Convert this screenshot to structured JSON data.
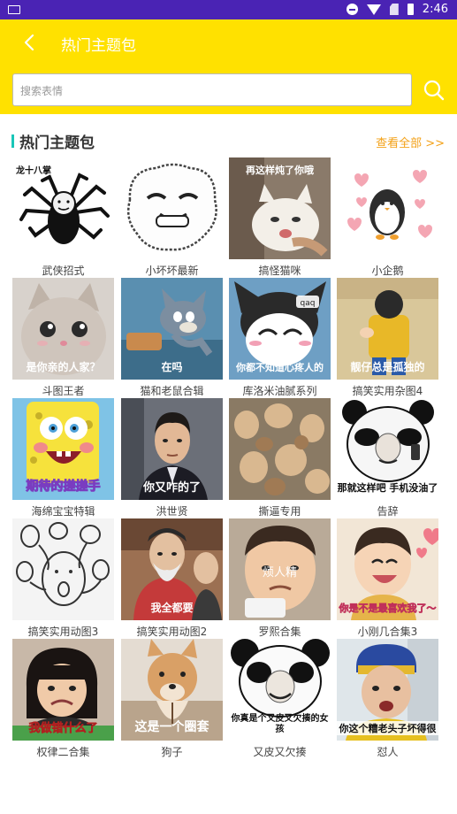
{
  "status_bar": {
    "time": "2:46"
  },
  "header": {
    "title": "热门主题包"
  },
  "search": {
    "placeholder": "搜索表情"
  },
  "section": {
    "title": "热门主题包",
    "view_all": "查看全部 >>"
  },
  "packs": [
    {
      "name": "武侠招式",
      "overlay": "龙十八掌"
    },
    {
      "name": "小坏坏最新",
      "overlay": ""
    },
    {
      "name": "搞怪猫咪",
      "overlay": "再这样炖了你哦"
    },
    {
      "name": "小企鹅",
      "overlay": ""
    },
    {
      "name": "斗图王者",
      "overlay": "是你亲的人家？"
    },
    {
      "name": "猫和老鼠合辑",
      "overlay": "在吗"
    },
    {
      "name": "库洛米油腻系列",
      "overlay": "你都不知道心疼人的"
    },
    {
      "name": "搞笑实用杂图4",
      "overlay": "靓仔总是孤独的"
    },
    {
      "name": "海绵宝宝特辑",
      "overlay": "期待的搓搓手"
    },
    {
      "name": "洪世贤",
      "overlay": "你又咋的了"
    },
    {
      "name": "撕逼专用",
      "overlay": ""
    },
    {
      "name": "告辞",
      "overlay": "那就这样吧 手机没油了"
    },
    {
      "name": "搞笑实用动图3",
      "overlay": ""
    },
    {
      "name": "搞笑实用动图2",
      "overlay": "我全都要"
    },
    {
      "name": "罗熙合集",
      "overlay": "烦人精"
    },
    {
      "name": "小刚几合集3",
      "overlay": "你是不是最喜欢我了～"
    },
    {
      "name": "权律二合集",
      "overlay": "我做错什么了"
    },
    {
      "name": "狗子",
      "overlay": "这是一个圈套"
    },
    {
      "name": "又皮又欠揍",
      "overlay": "你真是个又皮又欠揍的女孩"
    },
    {
      "name": "怼人",
      "overlay": "你这个糟老头子坏得很"
    }
  ]
}
